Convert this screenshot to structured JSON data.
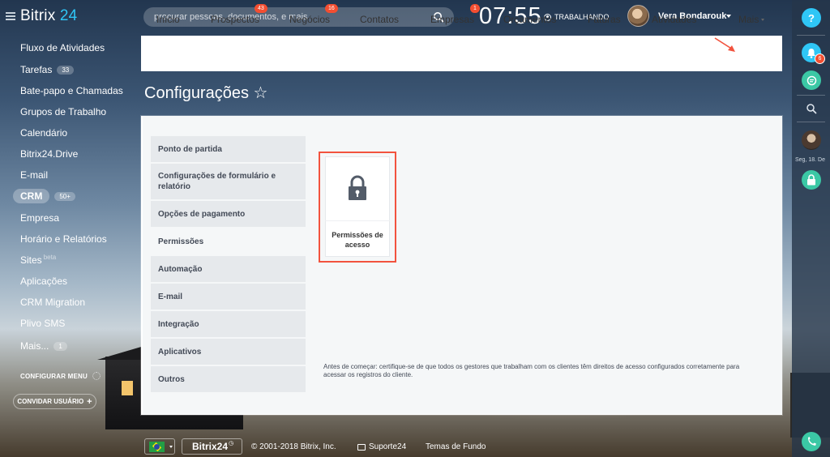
{
  "header": {
    "logo_main": "Bitrix",
    "logo_accent": "24",
    "search_placeholder": "procurar pessoas, documentos, e mais",
    "clock": "07:55",
    "work_status": "TRABALHANDO",
    "user_name": "Vera Bondarouk"
  },
  "sidebar": {
    "items": [
      {
        "label": "Fluxo de Atividades",
        "badge": ""
      },
      {
        "label": "Tarefas",
        "badge": "33"
      },
      {
        "label": "Bate-papo e Chamadas",
        "badge": ""
      },
      {
        "label": "Grupos de Trabalho",
        "badge": ""
      },
      {
        "label": "Calendário",
        "badge": ""
      },
      {
        "label": "Bitrix24.Drive",
        "badge": ""
      },
      {
        "label": "E-mail",
        "badge": ""
      },
      {
        "label": "CRM",
        "badge": "50+"
      },
      {
        "label": "Empresa",
        "badge": ""
      },
      {
        "label": "Horário e Relatórios",
        "badge": ""
      },
      {
        "label": "Sites",
        "badge": "",
        "suffix": "beta"
      },
      {
        "label": "Aplicações",
        "badge": ""
      },
      {
        "label": "CRM Migration",
        "badge": ""
      },
      {
        "label": "Plivo SMS",
        "badge": ""
      },
      {
        "label": "Mais...",
        "badge": "1"
      }
    ],
    "configure_menu": "CONFIGURAR MENU",
    "invite_user": "CONVIDAR USUÁRIO"
  },
  "main_nav": {
    "items": [
      {
        "label": "Início",
        "counter": ""
      },
      {
        "label": "Prospectos",
        "counter": "43"
      },
      {
        "label": "Negócios",
        "counter": "16"
      },
      {
        "label": "Contatos",
        "counter": ""
      },
      {
        "label": "Empresas",
        "counter": "1"
      },
      {
        "label": "Orçamentos",
        "counter": ""
      },
      {
        "label": "Faturas",
        "counter": ""
      },
      {
        "label": "Atividades",
        "counter": ""
      },
      {
        "label": "Mais",
        "counter": ""
      }
    ]
  },
  "page": {
    "title": "Configurações ☆"
  },
  "settings_menu": {
    "items": [
      "Ponto de partida",
      "Configurações de formulário e relatório",
      "Opções de pagamento",
      "Permissões",
      "Automação",
      "E-mail",
      "Integração",
      "Aplicativos",
      "Outros"
    ],
    "selected": "Permissões"
  },
  "tile": {
    "label": "Permissões de acesso",
    "icon": "lock-icon"
  },
  "note": "Antes de começar: certifique-se de que todos os gestores que trabalham com os clientes têm direitos de acesso configurados corretamente para acessar os registros do cliente.",
  "footer": {
    "brand": "Bitrix24",
    "copyright": "© 2001-2018 Bitrix, Inc.",
    "support": "Suporte24",
    "themes": "Temas de Fundo"
  },
  "right_panel": {
    "help": "?",
    "notifications_count": "6",
    "date_label": "Seg, 18. De"
  },
  "colors": {
    "accent": "#2fc6f6",
    "counter_red": "#f34e31",
    "highlight_red": "#f2533e",
    "green": "#3bc8a5"
  }
}
